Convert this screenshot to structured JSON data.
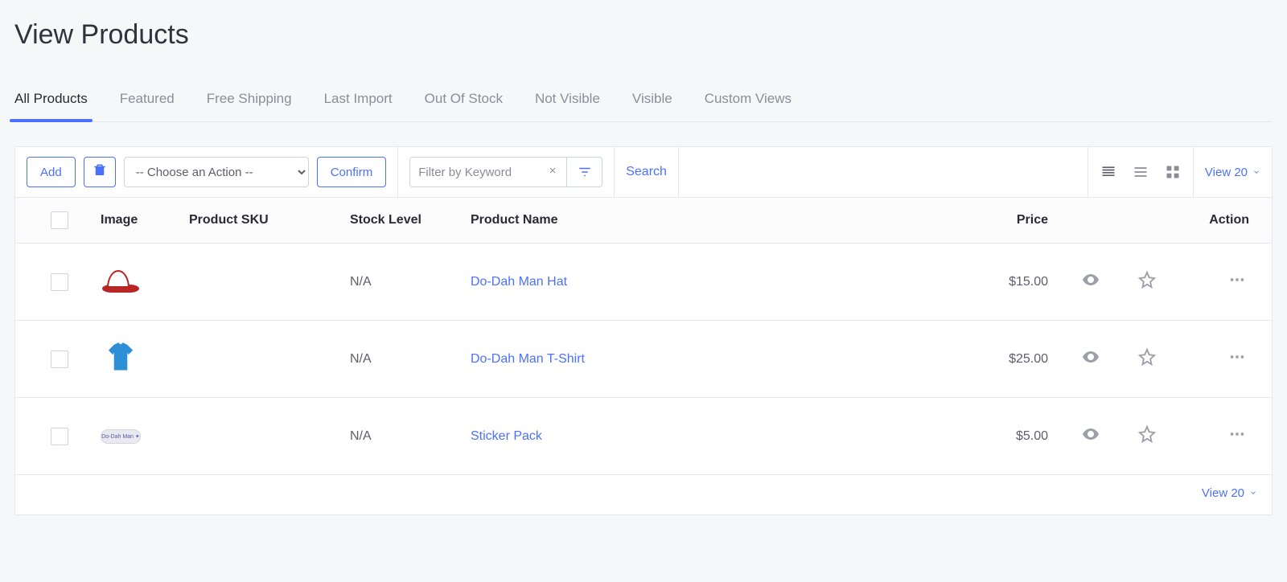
{
  "page": {
    "title": "View Products"
  },
  "tabs": [
    {
      "label": "All Products",
      "active": true
    },
    {
      "label": "Featured",
      "active": false
    },
    {
      "label": "Free Shipping",
      "active": false
    },
    {
      "label": "Last Import",
      "active": false
    },
    {
      "label": "Out Of Stock",
      "active": false
    },
    {
      "label": "Not Visible",
      "active": false
    },
    {
      "label": "Visible",
      "active": false
    },
    {
      "label": "Custom Views",
      "active": false
    }
  ],
  "toolbar": {
    "add_label": "Add",
    "action_placeholder": "-- Choose an Action --",
    "confirm_label": "Confirm",
    "filter_placeholder": "Filter by Keyword",
    "search_label": "Search",
    "view_count_label": "View 20"
  },
  "columns": {
    "image": "Image",
    "sku": "Product SKU",
    "stock": "Stock Level",
    "name": "Product Name",
    "price": "Price",
    "action": "Action"
  },
  "rows": [
    {
      "thumb": "hat",
      "sku": "",
      "stock": "N/A",
      "name": "Do-Dah Man Hat",
      "price": "$15.00"
    },
    {
      "thumb": "tshirt",
      "sku": "",
      "stock": "N/A",
      "name": "Do-Dah Man T-Shirt",
      "price": "$25.00"
    },
    {
      "thumb": "sticker",
      "sku": "",
      "stock": "N/A",
      "name": "Sticker Pack",
      "price": "$5.00"
    }
  ],
  "footer": {
    "view_count_label": "View 20"
  }
}
